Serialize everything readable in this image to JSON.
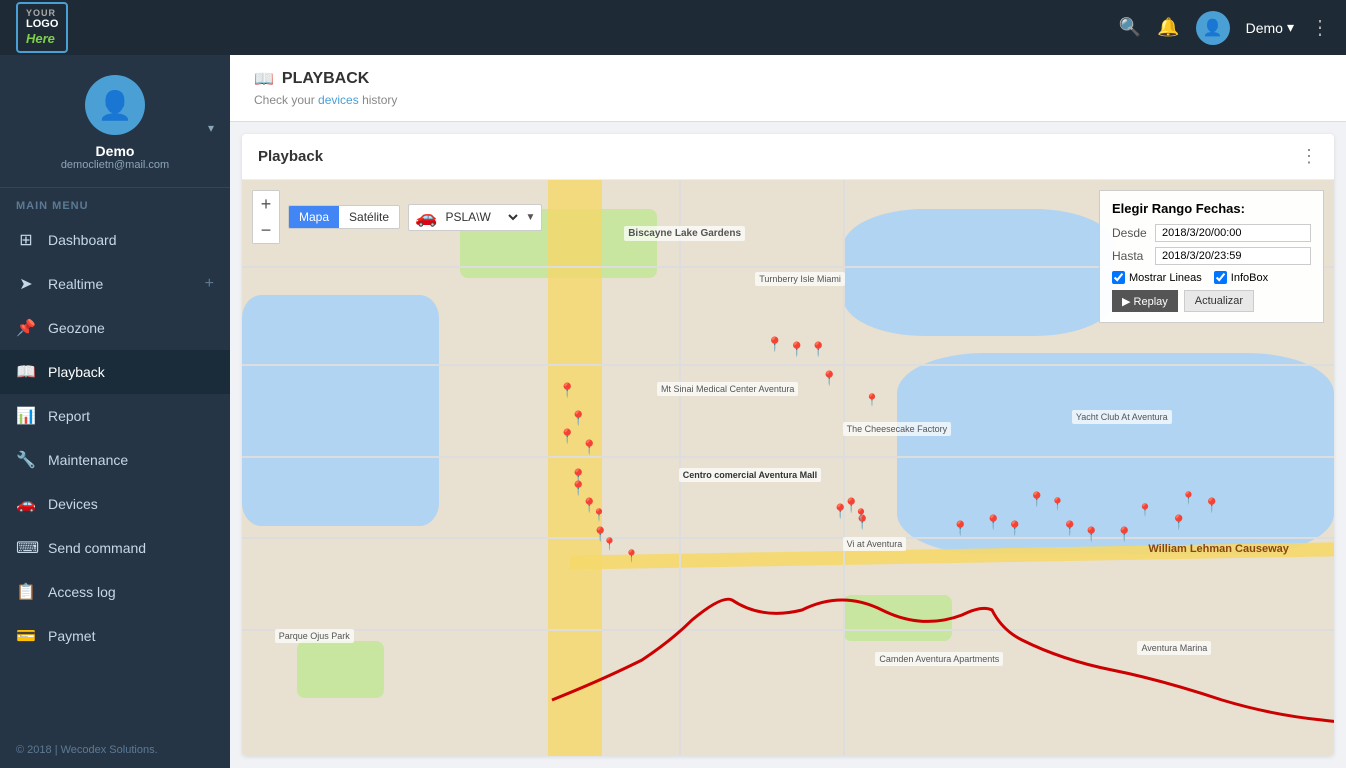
{
  "navbar": {
    "logo_line1": "YOUR",
    "logo_line2": "LOGO",
    "logo_accent": "Here",
    "user_label": "Demo",
    "user_dropdown": "▾",
    "search_icon": "🔍",
    "bell_icon": "🔔",
    "dots_icon": "⋮"
  },
  "sidebar": {
    "profile": {
      "name": "Demo",
      "email": "democlietn@mail.com"
    },
    "section_title": "MAIN MENU",
    "items": [
      {
        "id": "dashboard",
        "label": "Dashboard",
        "icon": "⊞"
      },
      {
        "id": "realtime",
        "label": "Realtime",
        "icon": "➤",
        "has_plus": true
      },
      {
        "id": "geozone",
        "label": "Geozone",
        "icon": "📌"
      },
      {
        "id": "playback",
        "label": "Playback",
        "icon": "📖",
        "active": true
      },
      {
        "id": "report",
        "label": "Report",
        "icon": "📊"
      },
      {
        "id": "maintenance",
        "label": "Maintenance",
        "icon": "🔧"
      },
      {
        "id": "devices",
        "label": "Devices",
        "icon": "🚗"
      },
      {
        "id": "send-command",
        "label": "Send command",
        "icon": "⌨"
      },
      {
        "id": "access-log",
        "label": "Access log",
        "icon": "📋"
      },
      {
        "id": "paymet",
        "label": "Paymet",
        "icon": "💳"
      }
    ]
  },
  "page_header": {
    "icon": "📖",
    "title": "PLAYBACK",
    "subtitle_pre": "Check your",
    "subtitle_link": "devices",
    "subtitle_post": "history"
  },
  "playback_panel": {
    "title": "Playback",
    "dots": "⋮"
  },
  "map_controls": {
    "zoom_in": "+",
    "zoom_out": "−",
    "map_type_buttons": [
      {
        "label": "Mapa",
        "active": true
      },
      {
        "label": "Satélite",
        "active": false
      }
    ],
    "device_name": "PSLA\\W"
  },
  "date_range": {
    "title": "Elegir Rango Fechas:",
    "desde_label": "Desde",
    "desde_value": "2018/3/20/00:00",
    "hasta_label": "Hasta",
    "hasta_value": "2018/3/20/23:59",
    "checkbox_lines": "Mostrar Lineas",
    "checkbox_infobox": "InfoBox",
    "btn_replay": "▶ Replay",
    "btn_actualizar": "Actualizar"
  },
  "footer": {
    "text": "© 2018 | Wecodex Solutions."
  }
}
